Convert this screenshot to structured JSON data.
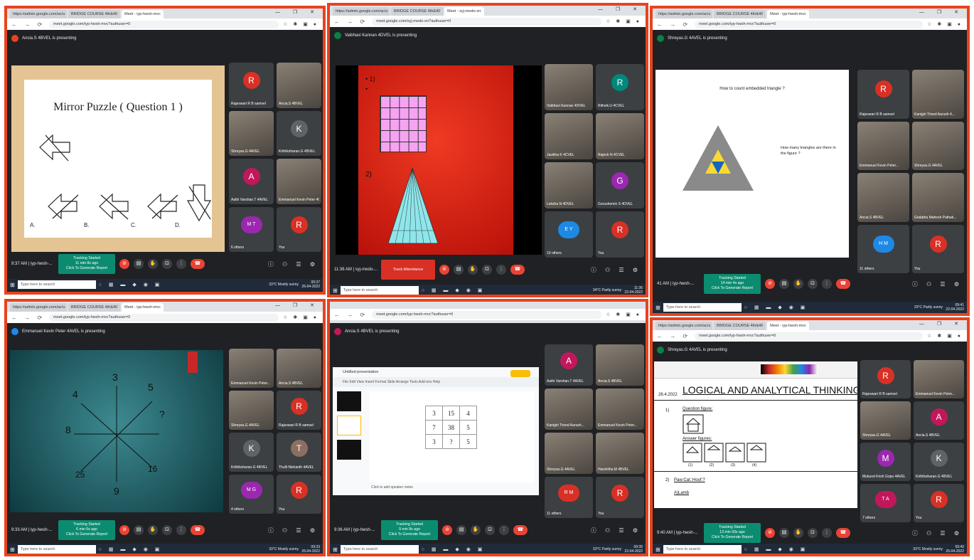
{
  "colors": {
    "frame": "#e8431e",
    "meet_bg": "#202124",
    "tracking": "#0b8c70",
    "end_call": "#ea4335"
  },
  "panels": [
    {
      "tabs": [
        "https://admin.google.com/ac/u",
        "BRIDGE COURSE 4th&40",
        "Meet - iyp-hwsh-mvc"
      ],
      "url": "meet.google.com/iyp-hwsh-mvc?authuser=0",
      "presenting": "Ancia.S 4BVEL is presenting",
      "slide_title": "Mirror Puzzle ( Question 1 )",
      "options": [
        "A.",
        "B.",
        "C.",
        "D."
      ],
      "tiles": [
        {
          "avatar": "R",
          "color": "#d93025",
          "name": "Rajeswari R B samvel"
        },
        {
          "avatar": "",
          "color": "",
          "name": "Ancia.S 4BVEL"
        },
        {
          "avatar": "",
          "color": "",
          "name": "Shreyas.G 4AVEL"
        },
        {
          "avatar": "K",
          "color": "#5f6368",
          "name": "Krithiksharan.G 4BVEL"
        },
        {
          "avatar": "A",
          "color": "#c2185b",
          "name": "Aathi Varshan.T 4AVEL"
        },
        {
          "avatar": "",
          "color": "",
          "name": "Emmanuel Kevin Peter 4CV"
        },
        {
          "avatar": "M T",
          "color": "#9c27b0",
          "name": "6 others"
        },
        {
          "avatar": "R",
          "color": "#d93025",
          "name": "You"
        }
      ],
      "time": "9:37 AM | iyp-hwsh-...",
      "tracking": [
        "Tracking Started",
        "11 min 8s ago",
        "Click To Generate Report"
      ],
      "search": "Type here to search",
      "weather": "33°C Mostly sunny",
      "tb_time": [
        "09:37",
        "26-04-2022"
      ]
    },
    {
      "tabs": [
        "https://admin.google.com/ac/u",
        "BRIDGE COURSE 4th&40",
        "Meet - syj-medo-xrr"
      ],
      "url": "meet.google.com/syj-medo-xrr?authuser=0",
      "presenting": "Vaibhavi Kannan 4DVEL is presenting",
      "labels": [
        "• 1)",
        "•",
        "2)"
      ],
      "tiles": [
        {
          "avatar": "",
          "color": "",
          "name": "Vaibhavi Kannan 4DVEL"
        },
        {
          "avatar": "R",
          "color": "#00897b",
          "name": "Rithvik.U 4CVEL"
        },
        {
          "avatar": "",
          "color": "",
          "name": "Jasikha K 4CVEL"
        },
        {
          "avatar": "",
          "color": "",
          "name": "Rajesh N 4CVEL"
        },
        {
          "avatar": "",
          "color": "",
          "name": "Leksha N 4DVEL"
        },
        {
          "avatar": "G",
          "color": "#9c27b0",
          "name": "Gurushemin S 4DVEL"
        },
        {
          "avatar": "E Y",
          "color": "#1e88e5",
          "name": "10 others"
        },
        {
          "avatar": "R",
          "color": "#d93025",
          "name": "You"
        }
      ],
      "time": "11:36 AM | syj-medo-...",
      "track_attendance": "Track Attendance",
      "search": "Type here to search",
      "weather": "34°C Partly sunny",
      "tb_time": [
        "11:36",
        "22-04-2022"
      ]
    },
    {
      "tabs": [
        "https://admin.google.com/ac/u",
        "BRIDGE COURSE 4th&40",
        "Meet - iyp-hwsh-mvc"
      ],
      "url": "meet.google.com/iyp-hwsh-mvc?authuser=0",
      "presenting": "Shreyas.G 4AVEL is presenting",
      "q1": "How to count embedded triangle ?",
      "q2": "How many triangles are there in the figure ?",
      "tiles": [
        {
          "avatar": "R",
          "color": "#d93025",
          "name": "Rajeswari R B samvel"
        },
        {
          "avatar": "",
          "color": "",
          "name": "Kanigiri Trived Aarush 4..."
        },
        {
          "avatar": "",
          "color": "",
          "name": "Emmanuel Kevin Peter..."
        },
        {
          "avatar": "",
          "color": "",
          "name": "Shreyas.G 4AVEL"
        },
        {
          "avatar": "",
          "color": "",
          "name": "Ancia.S 4BVEL"
        },
        {
          "avatar": "",
          "color": "",
          "name": "Godatha Mahesh Pathak..."
        },
        {
          "avatar": "H M",
          "color": "#1e88e5",
          "name": "11 others"
        },
        {
          "avatar": "R",
          "color": "#d93025",
          "name": "You"
        }
      ],
      "time": "41 AM | iyp-hwsh-...",
      "tracking": [
        "Tracking Started",
        "14 min 4s ago",
        "Click To Generate Report"
      ],
      "search": "Type here to search",
      "weather": "33°C Partly sunny",
      "tb_time": [
        "09:41",
        "22-04-2022"
      ]
    },
    {
      "tabs": [
        "https://admin.google.com/ac/u",
        "BRIDGE COURSE 4th&40",
        "Meet - iyp-hwsh-mvc"
      ],
      "url": "meet.google.com/iyp-hwsh-mvc?authuser=0",
      "presenting": "Emmanuel Kevin Peter 4AVEL is presenting",
      "numbers": [
        "3",
        "5",
        "4",
        "?",
        "8",
        "25",
        "9",
        "16"
      ],
      "tiles": [
        {
          "avatar": "",
          "color": "",
          "name": "Emmanuel Kevin Peter..."
        },
        {
          "avatar": "",
          "color": "",
          "name": "Ancia.S 4BVEL"
        },
        {
          "avatar": "",
          "color": "",
          "name": "Shreyas.G 4AVEL"
        },
        {
          "avatar": "R",
          "color": "#d93025",
          "name": "Rajeswari R B samvel"
        },
        {
          "avatar": "K",
          "color": "#5f6368",
          "name": "Krithiksharan.G 4BVEL"
        },
        {
          "avatar": "T",
          "color": "#8d6e63",
          "name": "Thulli Nishanth 4AVEL"
        },
        {
          "avatar": "M G",
          "color": "#9c27b0",
          "name": "4 others"
        },
        {
          "avatar": "R",
          "color": "#d93025",
          "name": "You"
        }
      ],
      "time": "9:33 AM | iyp-hwsh-...",
      "tracking": [
        "Tracking Started",
        "6 min 6s ago",
        "Click To Generate Report"
      ],
      "search": "Type here to search",
      "weather": "33°C Mostly sunny",
      "tb_time": [
        "09:33",
        "26-04-2022"
      ]
    },
    {
      "tabs": [
        "",
        "",
        ""
      ],
      "url": "meet.google.com/iyp-hwsh-mvc?authuser=0",
      "presenting": "Ancia.S 4BVEL is presenting",
      "doc_title": "Untitled presentation",
      "table": [
        [
          "3",
          "15",
          "4"
        ],
        [
          "7",
          "38",
          "5"
        ],
        [
          "3",
          "?",
          "5"
        ]
      ],
      "speaker_notes": "Click to add speaker notes",
      "tiles": [
        {
          "avatar": "A",
          "color": "#c2185b",
          "name": "Aathi Varshan.T 4AVEL"
        },
        {
          "avatar": "",
          "color": "",
          "name": "Ancia.S 4BVEL"
        },
        {
          "avatar": "",
          "color": "",
          "name": "Kanigiri Trived Aarush..."
        },
        {
          "avatar": "",
          "color": "",
          "name": "Emmanuel Kevin Peter..."
        },
        {
          "avatar": "",
          "color": "",
          "name": "Shreyas.G 4AVEL"
        },
        {
          "avatar": "",
          "color": "",
          "name": "Harshitha.M 4BVEL"
        },
        {
          "avatar": "R M",
          "color": "#d93025",
          "name": "11 others"
        },
        {
          "avatar": "R",
          "color": "#d93025",
          "name": "You"
        }
      ],
      "time": "9:36 AM | iyp-hwsh-...",
      "tracking": [
        "Tracking Started",
        "9 min 8s ago",
        "Click To Generate Report"
      ],
      "search": "Type here to search",
      "weather": "33°C Partly sunny",
      "tb_time": [
        "09:35",
        "22-04-2022"
      ]
    },
    {
      "tabs": [
        "https://admin.google.com/ac/u",
        "BRIDGE COURSE 4th&40",
        "Meet - iyp-hwsh-mvc"
      ],
      "url": "meet.google.com/iyp-hwsh-mvc?authuser=0",
      "presenting": "Shreyas.G 4AVEL is presenting",
      "date": "28.4.2022",
      "heading": "LOGICAL AND ANALYTICAL THINKING 2",
      "q_fig": "Question figure:",
      "a_fig": "Answer figures:",
      "q2": "Paw:Cat::Hoof:?",
      "a_opt": "A)Lamb",
      "tiles": [
        {
          "avatar": "R",
          "color": "#d93025",
          "name": "Rajeswari R B samvel"
        },
        {
          "avatar": "",
          "color": "",
          "name": "Emmanuel Kevin Peter..."
        },
        {
          "avatar": "",
          "color": "",
          "name": "Shreyas.G 4AVEL"
        },
        {
          "avatar": "A",
          "color": "#c2185b",
          "name": "Ancia.S 4BVEL"
        },
        {
          "avatar": "M",
          "color": "#9c27b0",
          "name": "Mukund Krish Gopu 4AVEL"
        },
        {
          "avatar": "K",
          "color": "#5f6368",
          "name": "Krithiksharan.G 4BVEL"
        },
        {
          "avatar": "T A",
          "color": "#c2185b",
          "name": "7 others"
        },
        {
          "avatar": "R",
          "color": "#d93025",
          "name": "You"
        }
      ],
      "time": "9:40 AM | iyp-hwsh-...",
      "tracking": [
        "Tracking Started",
        "13 min 50s ago",
        "Click To Generate Report"
      ],
      "search": "Type here to search",
      "weather": "33°C Mostly sunny",
      "tb_time": [
        "09:40",
        "26-04-2022"
      ]
    }
  ]
}
